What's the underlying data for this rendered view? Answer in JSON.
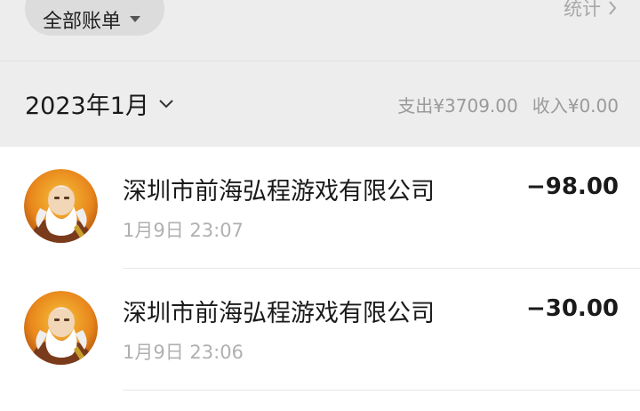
{
  "header": {
    "filter_label": "全部账单",
    "stats_label": "统计"
  },
  "month_bar": {
    "month_label": "2023年1月",
    "expense": "支出¥3709.00",
    "income": "收入¥0.00"
  },
  "transactions": [
    {
      "merchant": "深圳市前海弘程游戏有限公司",
      "time": "1月9日 23:07",
      "amount": "−98.00"
    },
    {
      "merchant": "深圳市前海弘程游戏有限公司",
      "time": "1月9日 23:06",
      "amount": "−30.00"
    }
  ],
  "colors": {
    "background": "#ededed",
    "list_background": "#ffffff",
    "pill": "#dcdcdc",
    "muted_text": "#9a9a9a",
    "primary_text": "#1a1a1a"
  },
  "icons": {
    "filter_caret": "caret-down-icon",
    "stats_chevron": "chevron-right-icon",
    "month_chevron": "chevron-down-icon",
    "avatar": "game-character-avatar"
  }
}
